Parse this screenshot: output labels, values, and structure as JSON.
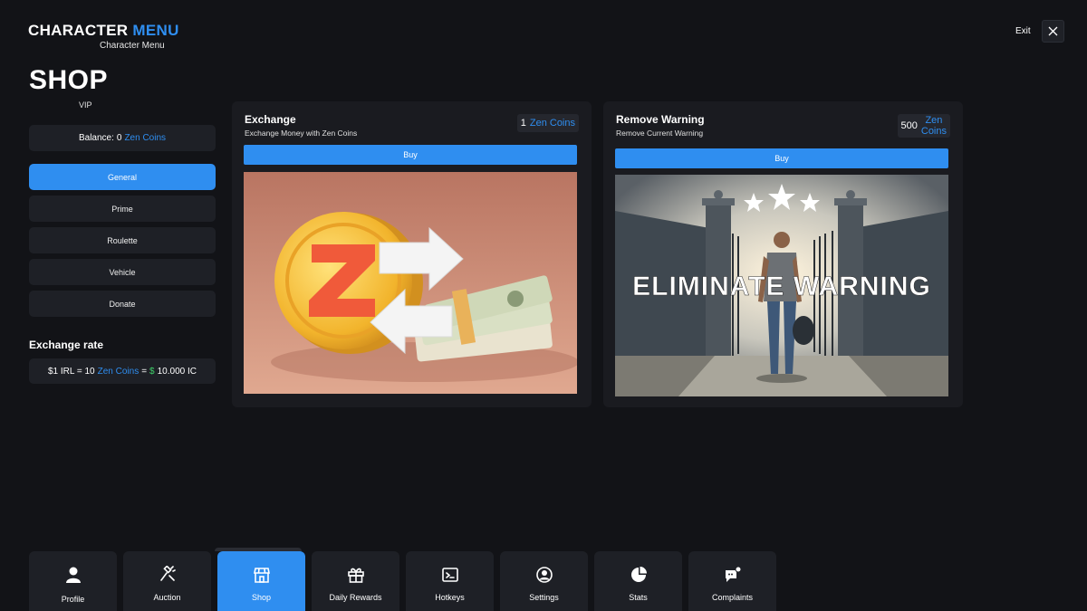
{
  "header": {
    "title_part1": "CHARACTER",
    "title_part2": "MENU",
    "subtitle": "Character Menu",
    "exit_label": "Exit"
  },
  "shop": {
    "title": "SHOP",
    "subtitle": "VIP",
    "balance_label": "Balance:",
    "balance_value": "0",
    "currency": "Zen Coins"
  },
  "categories": [
    {
      "label": "General",
      "active": true
    },
    {
      "label": "Prime",
      "active": false
    },
    {
      "label": "Roulette",
      "active": false
    },
    {
      "label": "Vehicle",
      "active": false
    },
    {
      "label": "Donate",
      "active": false
    }
  ],
  "exchange_rate": {
    "title": "Exchange rate",
    "left": "$1 IRL = 10",
    "currency": "Zen Coins",
    "equals": "=",
    "dollar": "$",
    "right": "10.000 IC"
  },
  "items": [
    {
      "title": "Exchange",
      "description": "Exchange Money with Zen Coins",
      "price": "1",
      "currency": "Zen Coins",
      "buy_label": "Buy",
      "image_icon": "zen-coin-exchange-illustration"
    },
    {
      "title": "Remove Warning",
      "description": "Remove Current Warning",
      "price": "500",
      "currency_line1": "Zen",
      "currency_line2": "Coins",
      "buy_label": "Buy",
      "image_text": "ELIMINATE WARNING",
      "image_icon": "prison-gate-illustration"
    }
  ],
  "bottom_nav": [
    {
      "label": "Profile",
      "icon": "user-icon"
    },
    {
      "label": "Auction",
      "icon": "gavel-icon"
    },
    {
      "label": "Shop",
      "icon": "store-icon",
      "active": true
    },
    {
      "label": "Daily Rewards",
      "icon": "gift-icon"
    },
    {
      "label": "Hotkeys",
      "icon": "terminal-icon"
    },
    {
      "label": "Settings",
      "icon": "user-circle-icon"
    },
    {
      "label": "Stats",
      "icon": "pie-chart-icon"
    },
    {
      "label": "Complaints",
      "icon": "chat-alert-icon"
    }
  ],
  "colors": {
    "accent": "#2f8ef0",
    "background": "#121317",
    "panel": "#1e2026",
    "green": "#3fd16a"
  }
}
